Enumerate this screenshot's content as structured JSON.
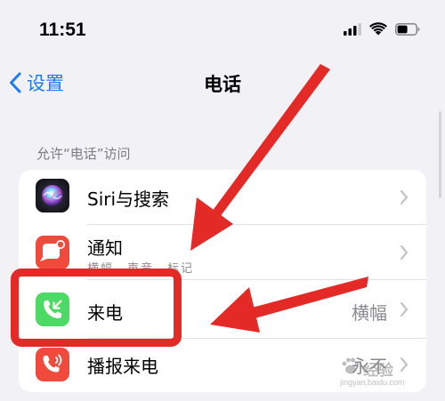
{
  "status_bar": {
    "time": "11:51",
    "icons": [
      "cellular-signal-icon",
      "wifi-icon",
      "battery-icon"
    ]
  },
  "nav": {
    "back_label": "设置",
    "title": "电话"
  },
  "section": {
    "header": "允许“电话”访问"
  },
  "rows": [
    {
      "label": "Siri与搜索",
      "sublabel": "",
      "value": "",
      "icon": "siri-icon"
    },
    {
      "label": "通知",
      "sublabel": "横幅、声音、标记",
      "value": "",
      "icon": "notifications-icon"
    },
    {
      "label": "来电",
      "sublabel": "",
      "value": "横幅",
      "icon": "incoming-call-icon"
    },
    {
      "label": "播报来电",
      "sublabel": "",
      "value": "永不",
      "icon": "announce-calls-icon"
    }
  ],
  "watermark": {
    "text": "经验",
    "url": "jingyan.baidu.com"
  },
  "colors": {
    "accent": "#1e7cf2",
    "annotation": "#e32a27",
    "background": "#f2f1f6",
    "phone_green": "#4cd964",
    "notification_red": "#f04a3c"
  }
}
